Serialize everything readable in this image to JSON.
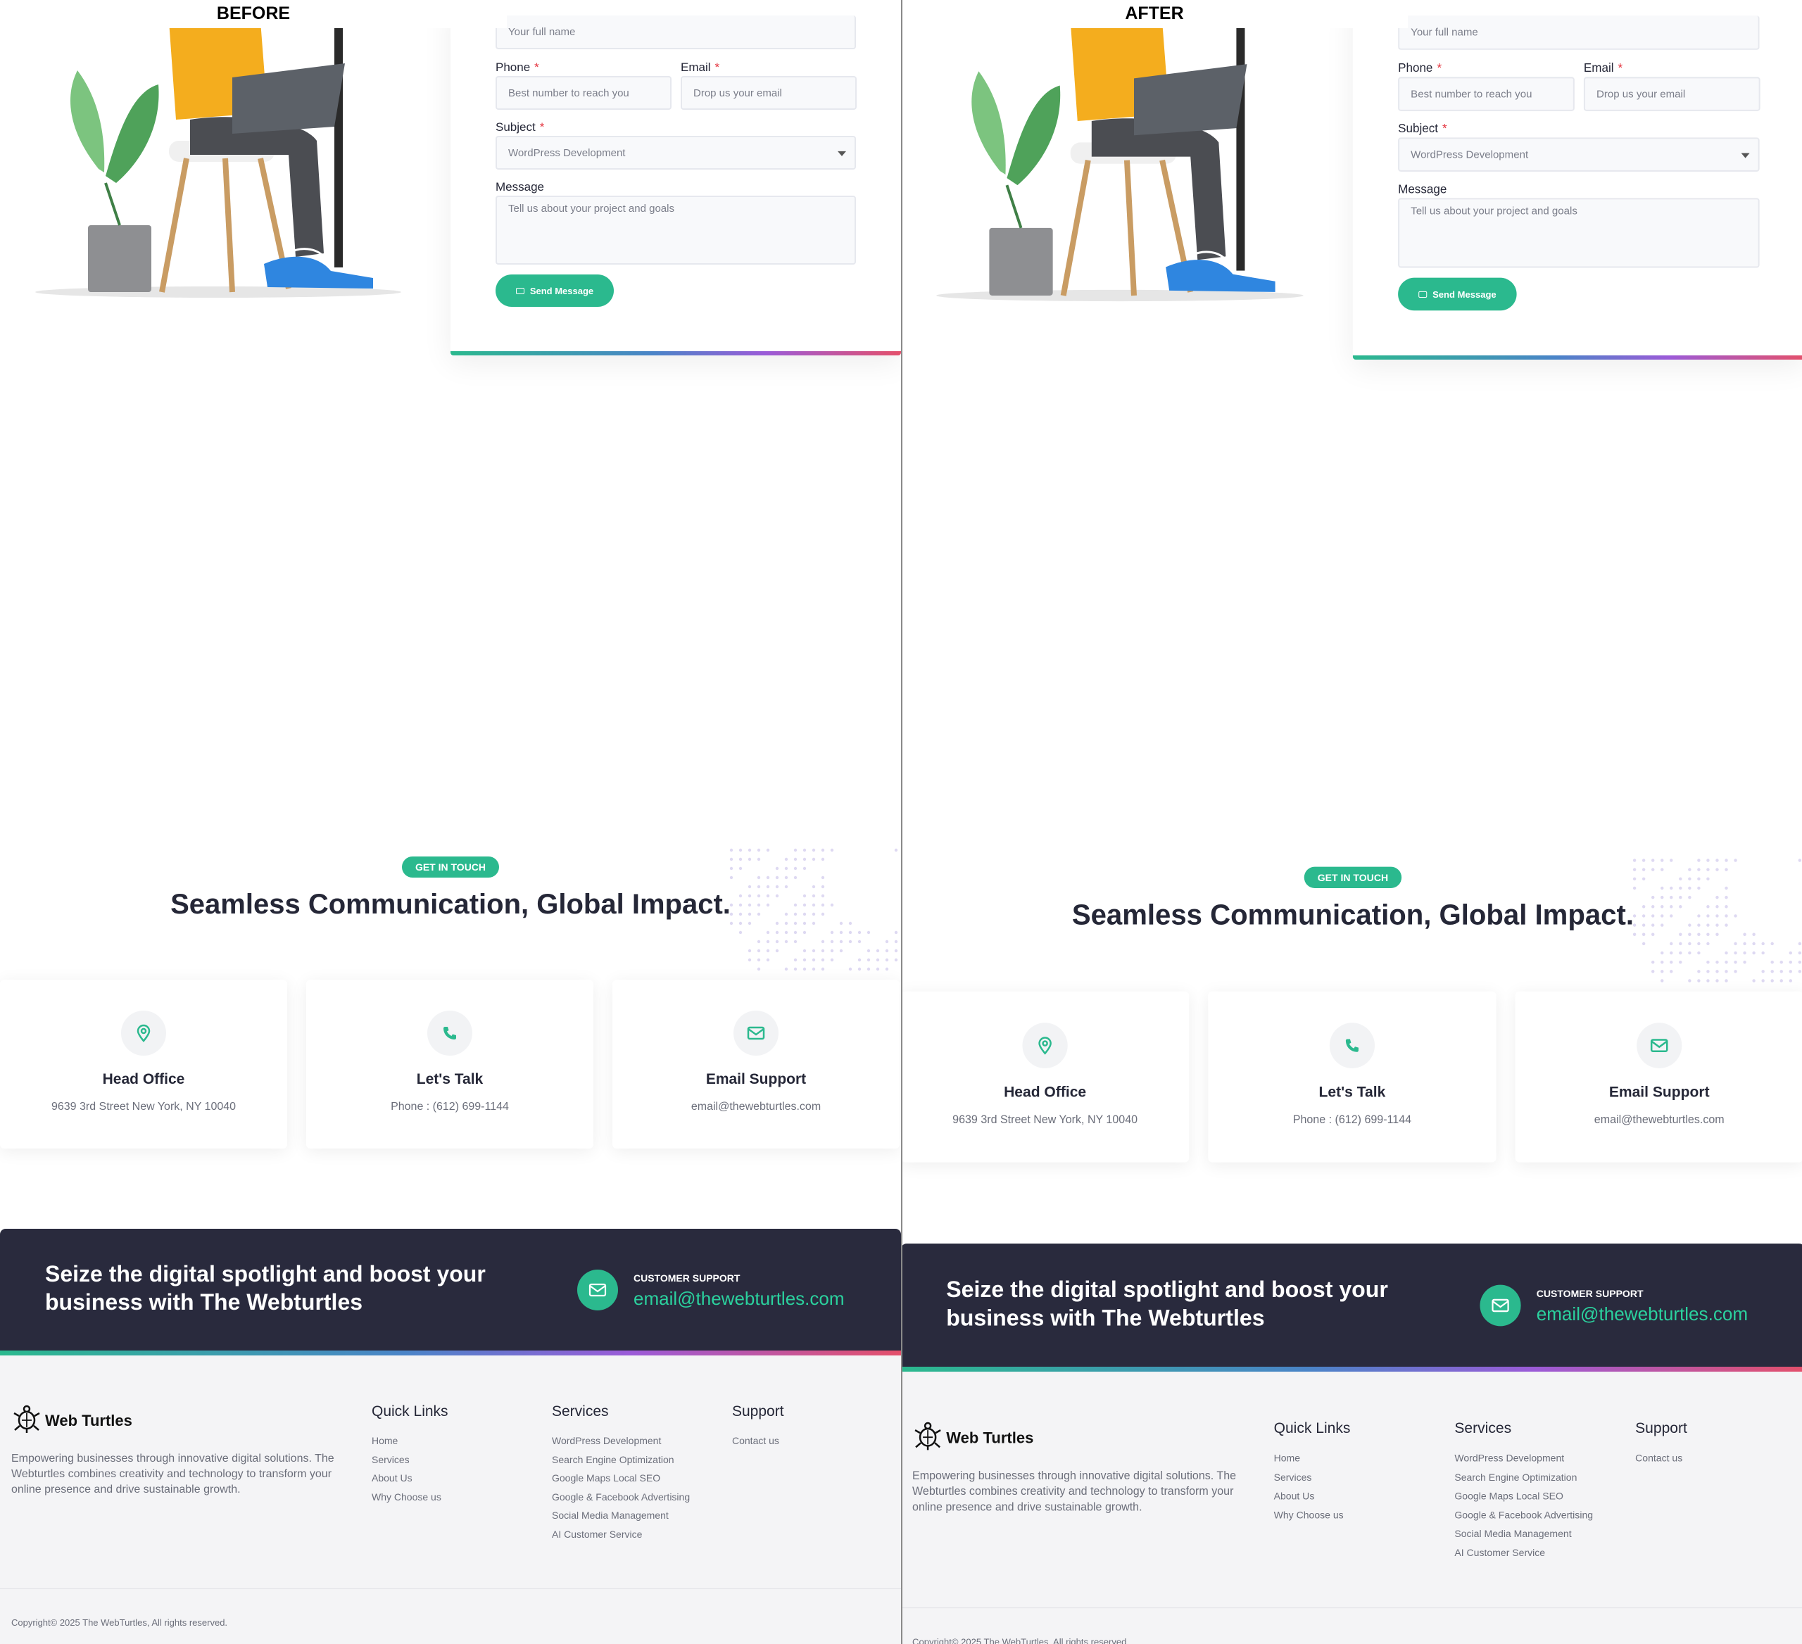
{
  "panels": {
    "before_label": "BEFORE",
    "after_label": "AFTER"
  },
  "form": {
    "name_placeholder": "Your full name",
    "phone_label": "Phone",
    "phone_placeholder": "Best number to reach you",
    "email_label": "Email",
    "email_placeholder": "Drop us your email",
    "required_mark": "*",
    "subject_label": "Subject",
    "subject_value": "WordPress Development",
    "message_label": "Message",
    "message_placeholder": "Tell us about your project and goals",
    "send_label": "Send Message"
  },
  "touch": {
    "pill": "GET IN TOUCH",
    "heading": "Seamless Communication, Global Impact."
  },
  "cards": [
    {
      "icon": "map-pin-icon",
      "title": "Head Office",
      "text": "9639 3rd Street New York, NY 10040"
    },
    {
      "icon": "phone-icon",
      "title": "Let's Talk",
      "text": "Phone : (612) 699-1144"
    },
    {
      "icon": "mail-icon",
      "title": "Email Support",
      "text": "email@thewebturtles.com"
    }
  ],
  "cta": {
    "text": "Seize the digital spotlight and boost your business with The Webturtles",
    "support_label": "CUSTOMER SUPPORT",
    "support_email": "email@thewebturtles.com"
  },
  "footer": {
    "brand": "Web Turtles",
    "description": "Empowering businesses through innovative digital solutions. The Webturtles combines creativity and technology to transform your online presence and drive sustainable growth.",
    "quick_links": {
      "title": "Quick Links",
      "items": [
        "Home",
        "Services",
        "About Us",
        "Why Choose us"
      ]
    },
    "services": {
      "title": "Services",
      "items": [
        "WordPress Development",
        "Search Engine Optimization",
        "Google Maps Local SEO",
        "Google & Facebook Advertising",
        "Social Media Management",
        "AI Customer Service"
      ]
    },
    "support": {
      "title": "Support",
      "items": [
        "Contact us"
      ]
    },
    "copyright": "Copyright© 2025 The WebTurtles, All rights reserved."
  },
  "colors": {
    "accent": "#2bb98e",
    "dark": "#292a3d",
    "text": "#252737",
    "muted": "#6b6e7a"
  }
}
